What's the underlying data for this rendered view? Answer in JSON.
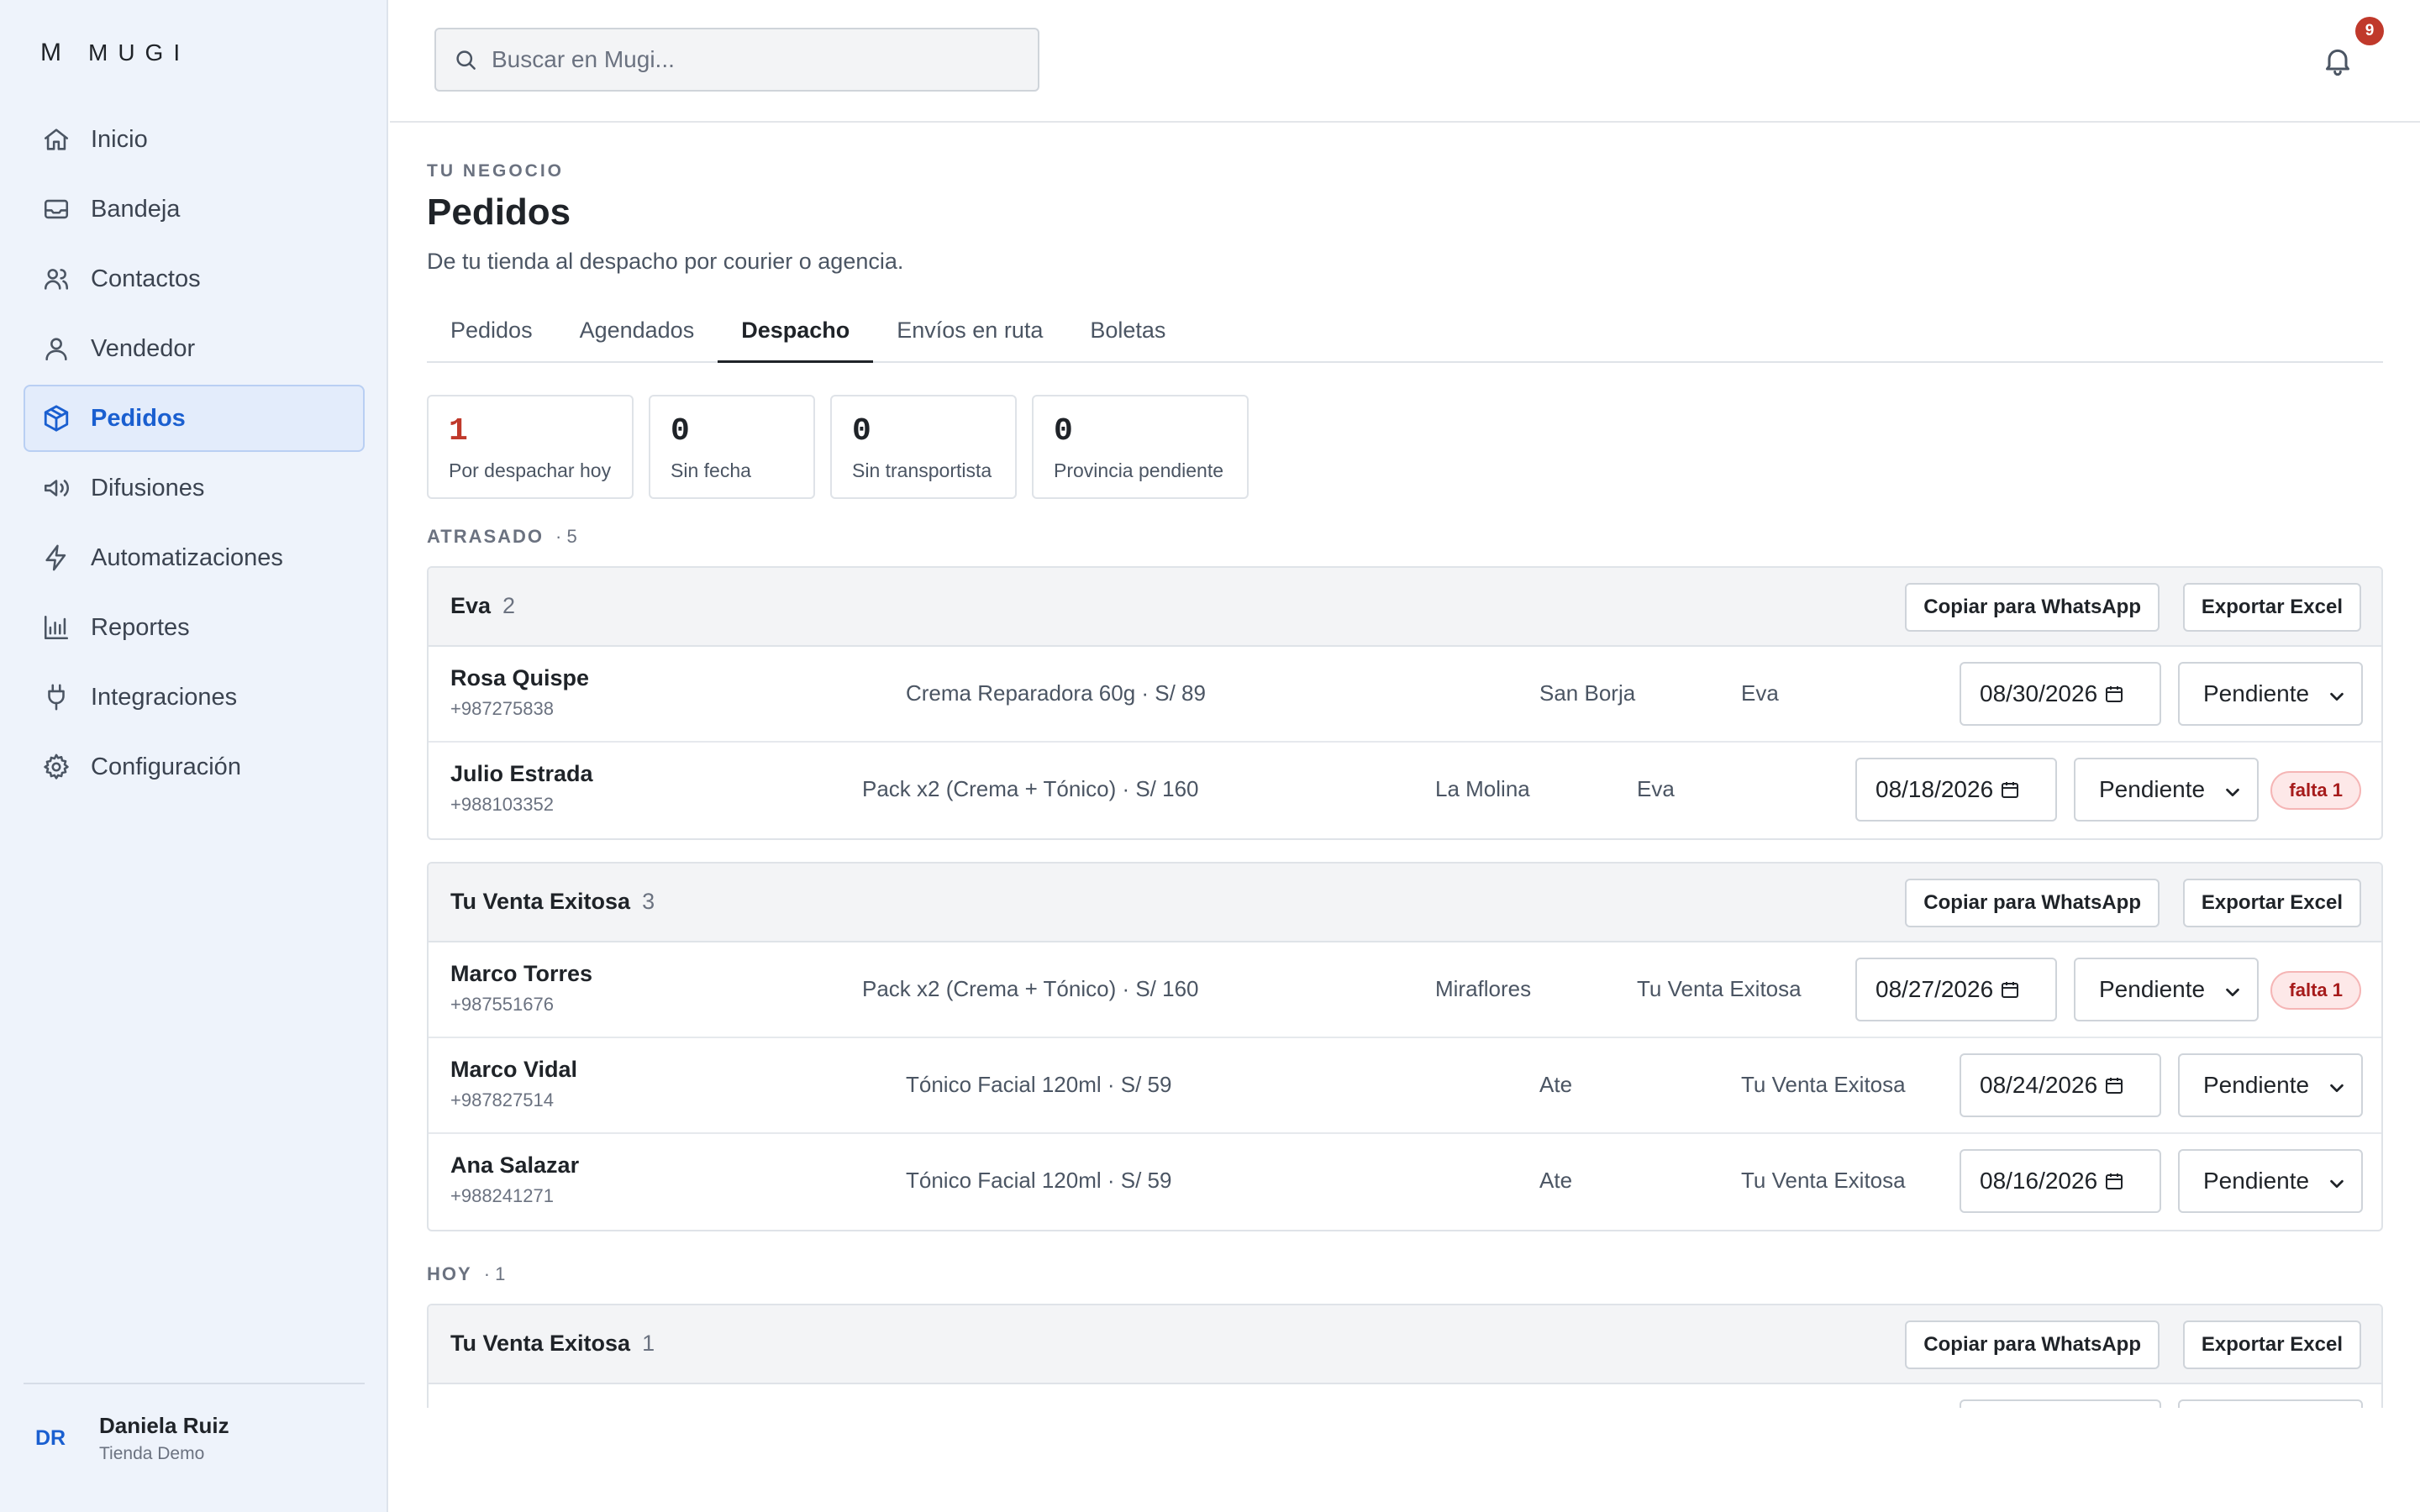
{
  "brand": {
    "mark": "M",
    "name": "MUGI"
  },
  "sidebar": {
    "items": [
      {
        "label": "Inicio",
        "icon": "home-icon"
      },
      {
        "label": "Bandeja",
        "icon": "inbox-icon"
      },
      {
        "label": "Contactos",
        "icon": "users-icon"
      },
      {
        "label": "Vendedor",
        "icon": "user-icon"
      },
      {
        "label": "Pedidos",
        "icon": "package-icon",
        "active": true
      },
      {
        "label": "Difusiones",
        "icon": "megaphone-icon"
      },
      {
        "label": "Automatizaciones",
        "icon": "bolt-icon"
      },
      {
        "label": "Reportes",
        "icon": "bar-chart-icon"
      },
      {
        "label": "Integraciones",
        "icon": "plug-icon"
      },
      {
        "label": "Configuración",
        "icon": "gear-icon"
      }
    ],
    "user": {
      "initials": "DR",
      "name": "Daniela Ruiz",
      "store": "Tienda Demo"
    }
  },
  "header": {
    "search_placeholder": "Buscar en Mugi...",
    "notification_count": "9"
  },
  "page": {
    "eyebrow": "TU NEGOCIO",
    "title": "Pedidos",
    "subtitle": "De tu tienda al despacho por courier o agencia."
  },
  "tabs": [
    {
      "label": "Pedidos"
    },
    {
      "label": "Agendados"
    },
    {
      "label": "Despacho",
      "active": true
    },
    {
      "label": "Envíos en ruta"
    },
    {
      "label": "Boletas"
    }
  ],
  "stats": [
    {
      "value": "1",
      "label": "Por despachar hoy",
      "highlight": true
    },
    {
      "value": "0",
      "label": "Sin fecha"
    },
    {
      "value": "0",
      "label": "Sin transportista"
    },
    {
      "value": "0",
      "label": "Provincia pendiente"
    }
  ],
  "buttons": {
    "whatsapp": "Copiar para WhatsApp",
    "excel": "Exportar Excel"
  },
  "sections": [
    {
      "label": "ATRASADO",
      "count": "· 5"
    },
    {
      "label": "HOY",
      "count": "· 1"
    }
  ],
  "groups": [
    {
      "name": "Eva",
      "count": "2",
      "rows": [
        {
          "name": "Rosa Quispe",
          "phone": "+987275838",
          "product": "Crema Reparadora 60g · S/ 89",
          "district": "San Borja",
          "carrier": "Eva",
          "date": "08/30/2026",
          "status": "Pendiente",
          "tag": ""
        },
        {
          "name": "Julio Estrada",
          "phone": "+988103352",
          "product": "Pack x2 (Crema + Tónico) · S/ 160",
          "district": "La Molina",
          "carrier": "Eva",
          "date": "08/18/2026",
          "status": "Pendiente",
          "tag": "falta 1"
        }
      ]
    },
    {
      "name": "Tu Venta Exitosa",
      "count": "3",
      "rows": [
        {
          "name": "Marco Torres",
          "phone": "+987551676",
          "product": "Pack x2 (Crema + Tónico) · S/ 160",
          "district": "Miraflores",
          "carrier": "Tu Venta Exitosa",
          "date": "08/27/2026",
          "status": "Pendiente",
          "tag": "falta 1"
        },
        {
          "name": "Marco Vidal",
          "phone": "+987827514",
          "product": "Tónico Facial 120ml · S/ 59",
          "district": "Ate",
          "carrier": "Tu Venta Exitosa",
          "date": "08/24/2026",
          "status": "Pendiente",
          "tag": ""
        },
        {
          "name": "Ana Salazar",
          "phone": "+988241271",
          "product": "Tónico Facial 120ml · S/ 59",
          "district": "Ate",
          "carrier": "Tu Venta Exitosa",
          "date": "08/16/2026",
          "status": "Pendiente",
          "tag": ""
        }
      ]
    },
    {
      "name": "Tu Venta Exitosa",
      "count": "1",
      "rows": []
    }
  ],
  "colors": {
    "accent": "#1a5fd0",
    "alert": "#c0392b",
    "sidebar_bg": "#eef3fb"
  }
}
